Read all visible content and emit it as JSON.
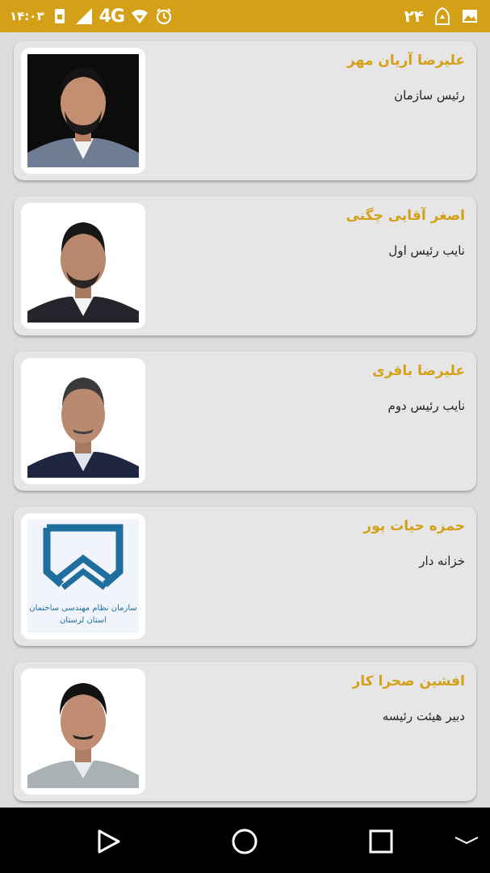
{
  "status_bar": {
    "time": "۱۴:۰۳",
    "network": "4G",
    "day_number": "۲۴",
    "icons": [
      "alarm-icon",
      "wifi-icon",
      "signal-icon",
      "sim-icon",
      "gallery-icon",
      "app-notification-icon"
    ]
  },
  "members": [
    {
      "name": "علیرضا آریان مهر",
      "role": "رئیس سازمان",
      "photo": "portrait-photo"
    },
    {
      "name": "اصغر آقایی چگنی",
      "role": "نایب رئیس اول",
      "photo": "portrait-photo"
    },
    {
      "name": "علیرضا باقری",
      "role": "نایب رئیس دوم",
      "photo": "portrait-photo"
    },
    {
      "name": "حمزه حیات پور",
      "role": "خزانه دار",
      "photo": "organization-logo",
      "logo_text_line1": "سازمان نظام مهندسی ساختمان",
      "logo_text_line2": "استان لرستان"
    },
    {
      "name": "افشین صحرا کار",
      "role": "دبیر هیئت رئیسه",
      "photo": "portrait-photo"
    }
  ],
  "nav_bar": {
    "buttons": [
      "back-triangle-icon",
      "home-circle-icon",
      "recents-square-icon",
      "collapse-chevron-icon"
    ]
  },
  "colors": {
    "accent": "#d4a017",
    "background": "#dcdcdc",
    "card": "#e6e6e6"
  }
}
